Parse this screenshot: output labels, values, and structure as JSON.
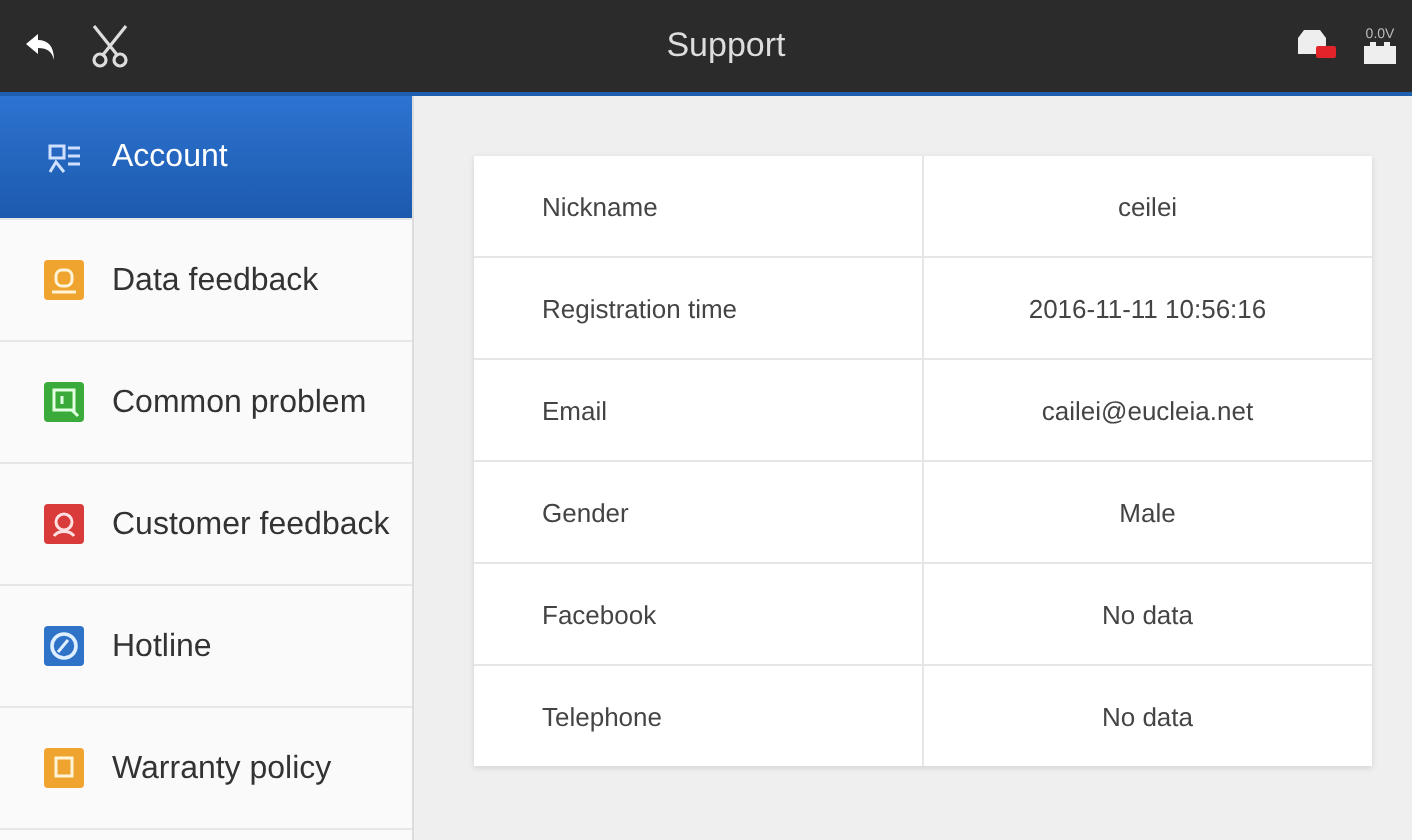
{
  "title_bar": {
    "title": "Support",
    "voltage": "0.0V"
  },
  "sidebar": {
    "items": [
      {
        "label": "Account",
        "kind": "account",
        "selected": true
      },
      {
        "label": "Data feedback",
        "kind": "data",
        "selected": false
      },
      {
        "label": "Common problem",
        "kind": "common",
        "selected": false
      },
      {
        "label": "Customer feedback",
        "kind": "customer",
        "selected": false
      },
      {
        "label": "Hotline",
        "kind": "hotline",
        "selected": false
      },
      {
        "label": "Warranty policy",
        "kind": "warranty",
        "selected": false
      }
    ]
  },
  "account_table": {
    "rows": [
      {
        "label": "Nickname",
        "value": "ceilei"
      },
      {
        "label": "Registration time",
        "value": "2016-11-11 10:56:16"
      },
      {
        "label": "Email",
        "value": "cailei@eucleia.net"
      },
      {
        "label": "Gender",
        "value": "Male"
      },
      {
        "label": "Facebook",
        "value": "No data"
      },
      {
        "label": "Telephone",
        "value": "No data"
      }
    ]
  }
}
